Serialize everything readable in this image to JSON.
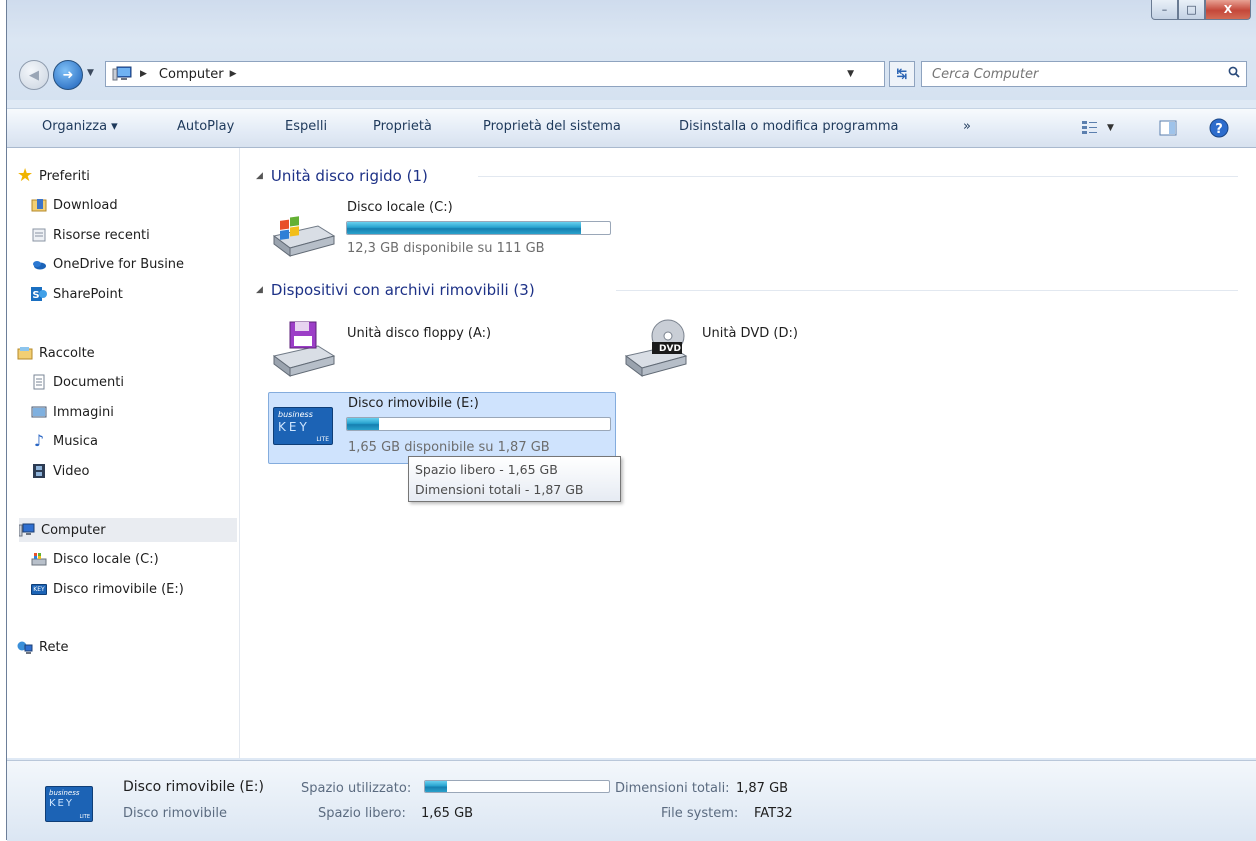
{
  "window": {
    "minimize": "–",
    "maximize": "□",
    "close": "X"
  },
  "address": {
    "crumb": "Computer",
    "search_placeholder": "Cerca Computer"
  },
  "toolbar": {
    "organize": "Organizza ▾",
    "autoplay": "AutoPlay",
    "eject": "Espelli",
    "properties": "Proprietà",
    "system_properties": "Proprietà del sistema",
    "uninstall": "Disinstalla o modifica programma",
    "more": "»"
  },
  "sidebar": {
    "favorites": "Preferiti",
    "download": "Download",
    "recent": "Risorse recenti",
    "onedrive": "OneDrive for Busine",
    "sharepoint": "SharePoint",
    "libraries": "Raccolte",
    "documents": "Documenti",
    "pictures": "Immagini",
    "music": "Musica",
    "video": "Video",
    "computer": "Computer",
    "local_disk": "Disco locale (C:)",
    "removable": "Disco rimovibile (E:)",
    "network": "Rete"
  },
  "groups": {
    "hdd": "Unità disco rigido (1)",
    "removable": "Dispositivi con archivi rimovibili (3)"
  },
  "drives": {
    "c": {
      "name": "Disco locale (C:)",
      "free": "12,3 GB disponibile su 111 GB",
      "used_fraction": 0.89
    },
    "a": {
      "name": "Unità disco floppy (A:)"
    },
    "d": {
      "name": "Unità DVD (D:)",
      "badge": "DVD"
    },
    "e": {
      "name": "Disco rimovibile (E:)",
      "free": "1,65 GB disponibile su 1,87 GB",
      "used_fraction": 0.12
    }
  },
  "tooltip": {
    "line1": "Spazio libero - 1,65 GB",
    "line2": "Dimensioni totali - 1,87 GB"
  },
  "details": {
    "name": "Disco rimovibile (E:)",
    "type": "Disco rimovibile",
    "used_label": "Spazio utilizzato:",
    "free_label": "Spazio libero:",
    "free_value": "1,65 GB",
    "total_label": "Dimensioni totali:",
    "total_value": "1,87 GB",
    "fs_label": "File system:",
    "fs_value": "FAT32",
    "used_fraction": 0.12
  },
  "logo": {
    "business": "business",
    "key": "KEY",
    "lite": "LITE",
    "small": "KEY"
  },
  "colors": {
    "accent": "#1e3287",
    "bar": "#28a3cf",
    "selection": "#cfe3fd"
  }
}
